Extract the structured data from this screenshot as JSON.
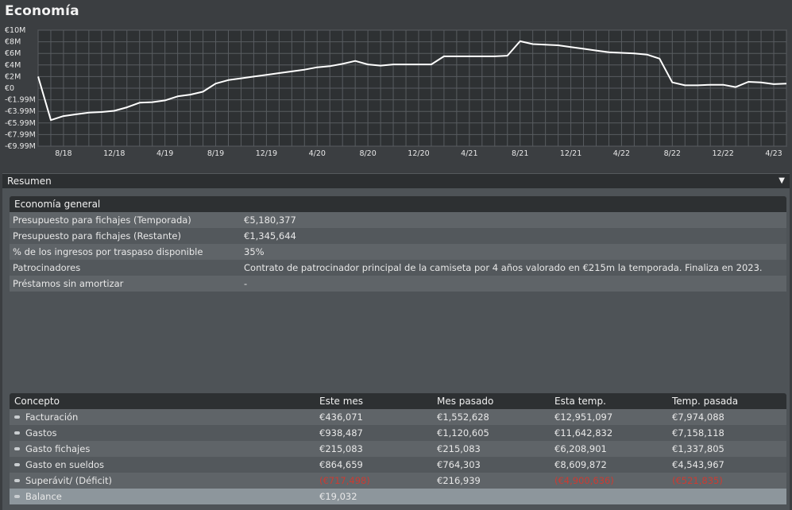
{
  "page_title": "Economía",
  "chart_data": {
    "type": "line",
    "title": "",
    "xlabel": "",
    "ylabel": "",
    "ylim": [
      -9.99,
      10
    ],
    "y_ticks": [
      "€10M",
      "€8M",
      "€6M",
      "€4M",
      "€2M",
      "€0",
      "-€1.99M",
      "-€3.99M",
      "-€5.99M",
      "-€7.99M",
      "-€9.99M"
    ],
    "x_ticks": [
      "8/18",
      "12/18",
      "4/19",
      "8/19",
      "12/19",
      "4/20",
      "8/20",
      "12/20",
      "4/21",
      "8/21",
      "12/21",
      "4/22",
      "8/22",
      "12/22",
      "4/23"
    ],
    "grid": true,
    "line_color": "#ffffff",
    "series": [
      {
        "x": [
          "6/18",
          "7/18",
          "8/18",
          "9/18",
          "10/18",
          "11/18",
          "12/18",
          "1/19",
          "2/19",
          "3/19",
          "4/19",
          "5/19",
          "6/19",
          "7/19",
          "8/19",
          "9/19",
          "10/19",
          "11/19",
          "12/19",
          "1/20",
          "2/20",
          "3/20",
          "4/20",
          "5/20",
          "6/20",
          "7/20",
          "8/20",
          "9/20",
          "10/20",
          "11/20",
          "12/20",
          "1/21",
          "2/21",
          "3/21",
          "4/21",
          "5/21",
          "6/21",
          "7/21",
          "8/21",
          "9/21",
          "10/21",
          "11/21",
          "12/21",
          "1/22",
          "2/22",
          "3/22",
          "4/22",
          "5/22",
          "6/22",
          "7/22",
          "8/22",
          "9/22",
          "10/22",
          "11/22",
          "12/22",
          "1/23",
          "2/23",
          "3/23",
          "4/23",
          "5/23"
        ],
        "values": [
          2.0,
          -5.5,
          -4.8,
          -4.5,
          -4.2,
          -4.1,
          -3.9,
          -3.3,
          -2.5,
          -2.4,
          -2.1,
          -1.4,
          -1.1,
          -0.6,
          0.8,
          1.4,
          1.7,
          2.0,
          2.3,
          2.6,
          2.9,
          3.2,
          3.6,
          3.8,
          4.2,
          4.7,
          4.1,
          3.9,
          4.1,
          4.1,
          4.1,
          4.1,
          5.5,
          5.5,
          5.5,
          5.5,
          5.5,
          5.6,
          8.1,
          7.6,
          7.5,
          7.4,
          7.1,
          6.8,
          6.5,
          6.2,
          6.1,
          6.0,
          5.8,
          5.1,
          1.0,
          0.5,
          0.5,
          0.6,
          0.6,
          0.2,
          1.1,
          1.0,
          0.7,
          0.8
        ]
      }
    ]
  },
  "resumen": {
    "label": "Resumen",
    "general": {
      "header": "Economía general",
      "rows": [
        {
          "label": "Presupuesto para fichajes (Temporada)",
          "value": "€5,180,377"
        },
        {
          "label": "Presupuesto para fichajes (Restante)",
          "value": "€1,345,644"
        },
        {
          "label": "% de los ingresos por traspaso disponible",
          "value": "35%"
        },
        {
          "label": "Patrocinadores",
          "value": "Contrato de patrocinador principal de la camiseta por 4 años valorado en €215m la temporada. Finaliza en 2023."
        },
        {
          "label": "Préstamos sin amortizar",
          "value": "-"
        }
      ]
    },
    "table": {
      "headers": [
        "Concepto",
        "Este mes",
        "Mes pasado",
        "Esta temp.",
        "Temp. pasada"
      ],
      "rows": [
        {
          "concept": "Facturación",
          "this_month": "€436,071",
          "last_month": "€1,552,628",
          "this_season": "€12,951,097",
          "last_season": "€7,974,088"
        },
        {
          "concept": "Gastos",
          "this_month": "€938,487",
          "last_month": "€1,120,605",
          "this_season": "€11,642,832",
          "last_season": "€7,158,118"
        },
        {
          "concept": "Gasto fichajes",
          "this_month": "€215,083",
          "last_month": "€215,083",
          "this_season": "€6,208,901",
          "last_season": "€1,337,805"
        },
        {
          "concept": "Gasto en sueldos",
          "this_month": "€864,659",
          "last_month": "€764,303",
          "this_season": "€8,609,872",
          "last_season": "€4,543,967"
        },
        {
          "concept": "Superávit/ (Déficit)",
          "this_month": "(€717,498)",
          "last_month": "€216,939",
          "this_season": "(€4,900,636)",
          "last_season": "(€521,835)"
        },
        {
          "concept": "Balance",
          "this_month": "€19,032",
          "last_month": "",
          "this_season": "",
          "last_season": ""
        }
      ]
    }
  },
  "colors": {
    "background": "#3b3e41",
    "negative": "#cc3b32",
    "highlight_row": "#8d969c"
  }
}
